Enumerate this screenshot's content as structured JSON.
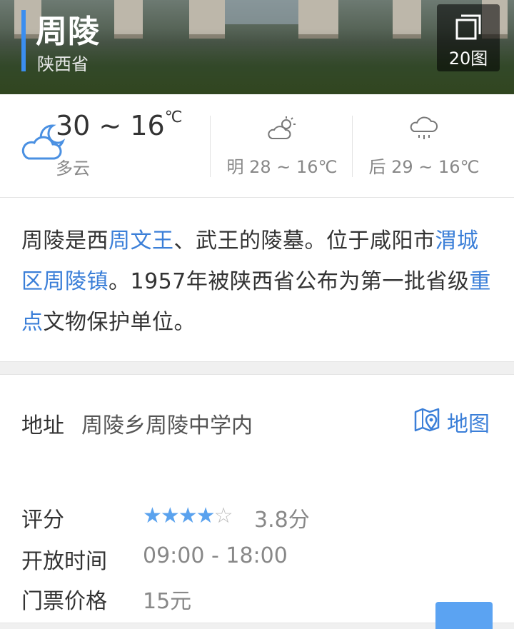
{
  "header": {
    "title": "周陵",
    "subtitle": "陕西省",
    "gallery_count": "20图"
  },
  "weather": {
    "today": {
      "temp": "30 ~ 16",
      "unit": "℃",
      "desc": "多云",
      "icon": "cloudy-night-icon"
    },
    "tomorrow": {
      "text": "明 28 ~ 16℃",
      "icon": "partly-sunny-icon"
    },
    "after": {
      "text": "后 29 ~ 16℃",
      "icon": "rain-icon"
    }
  },
  "description": {
    "p1": "周陵是西",
    "link1": "周文王",
    "p2": "、武王的陵墓。位于咸阳市",
    "link2": "渭城区周陵镇",
    "p3": "。1957年被陕西省公布为第一批省级",
    "link3": "重点",
    "p4": "文物保护单位。"
  },
  "address": {
    "label": "地址",
    "value": "周陵乡周陵中学内",
    "map_label": "地图"
  },
  "info": {
    "rating_label": "评分",
    "rating_value": 3.8,
    "rating_text": "3.8分",
    "stars_filled": "★★★★",
    "stars_empty": "☆",
    "hours_label": "开放时间",
    "hours_value": "09:00 - 18:00",
    "ticket_label": "门票价格",
    "ticket_value": "15元"
  },
  "colors": {
    "accent": "#3b8ef0",
    "link": "#3b7fd8",
    "star": "#5aa2ee"
  }
}
